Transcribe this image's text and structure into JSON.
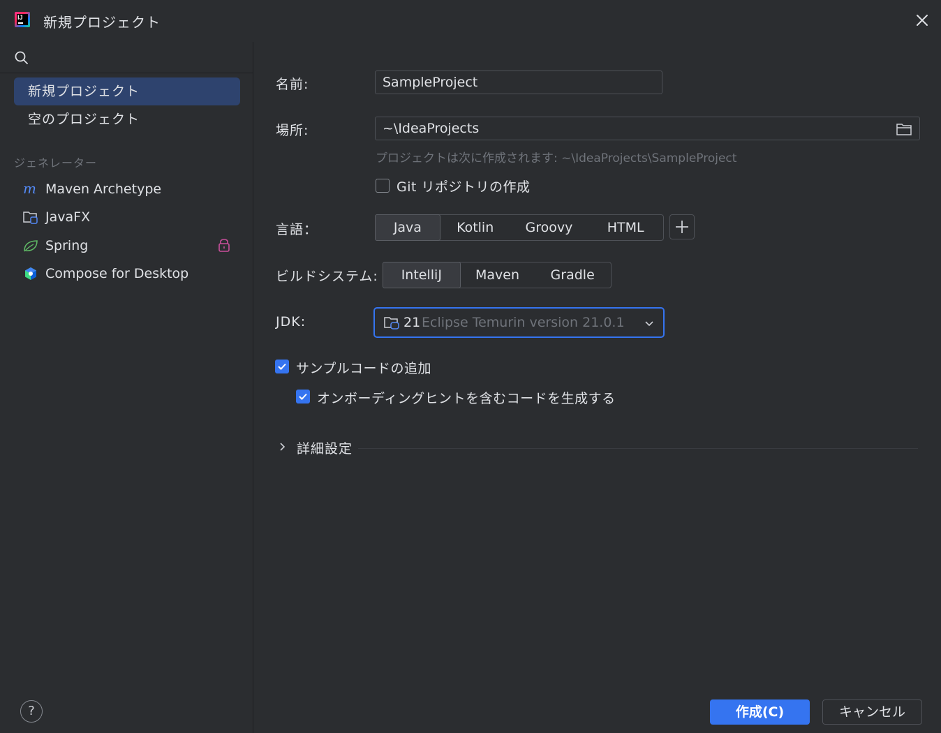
{
  "window": {
    "title": "新規プロジェクト"
  },
  "sidebar": {
    "items": [
      {
        "label": "新規プロジェクト",
        "selected": true
      },
      {
        "label": "空のプロジェクト",
        "selected": false
      }
    ],
    "generators_label": "ジェネレーター",
    "generators": [
      {
        "label": "Maven Archetype",
        "icon": "maven-icon"
      },
      {
        "label": "JavaFX",
        "icon": "javafx-folder-icon"
      },
      {
        "label": "Spring",
        "icon": "spring-leaf-icon",
        "locked": true
      },
      {
        "label": "Compose for Desktop",
        "icon": "compose-icon"
      }
    ],
    "help": "?"
  },
  "form": {
    "name_label": "名前:",
    "name_value": "SampleProject",
    "location_label": "場所:",
    "location_value": "~\\IdeaProjects",
    "location_hint": "プロジェクトは次に作成されます: ~\\IdeaProjects\\SampleProject",
    "git_label": "Git リポジトリの作成",
    "git_checked": false,
    "language_label": "言語：",
    "languages": [
      "Java",
      "Kotlin",
      "Groovy",
      "HTML"
    ],
    "language_selected": "Java",
    "build_label": "ビルドシステム:",
    "build_systems": [
      "IntelliJ",
      "Maven",
      "Gradle"
    ],
    "build_selected": "IntelliJ",
    "jdk_label": "JDK:",
    "jdk_version": "21",
    "jdk_name": "Eclipse Temurin version 21.0.1",
    "sample_code_label": "サンプルコードの追加",
    "sample_code_checked": true,
    "onboarding_label": "オンボーディングヒントを含むコードを生成する",
    "onboarding_checked": true,
    "advanced_label": "詳細設定"
  },
  "footer": {
    "create_label": "作成(C)",
    "cancel_label": "キャンセル"
  },
  "colors": {
    "accent": "#3574f0",
    "background": "#2b2d30",
    "selection": "#2e436e"
  }
}
